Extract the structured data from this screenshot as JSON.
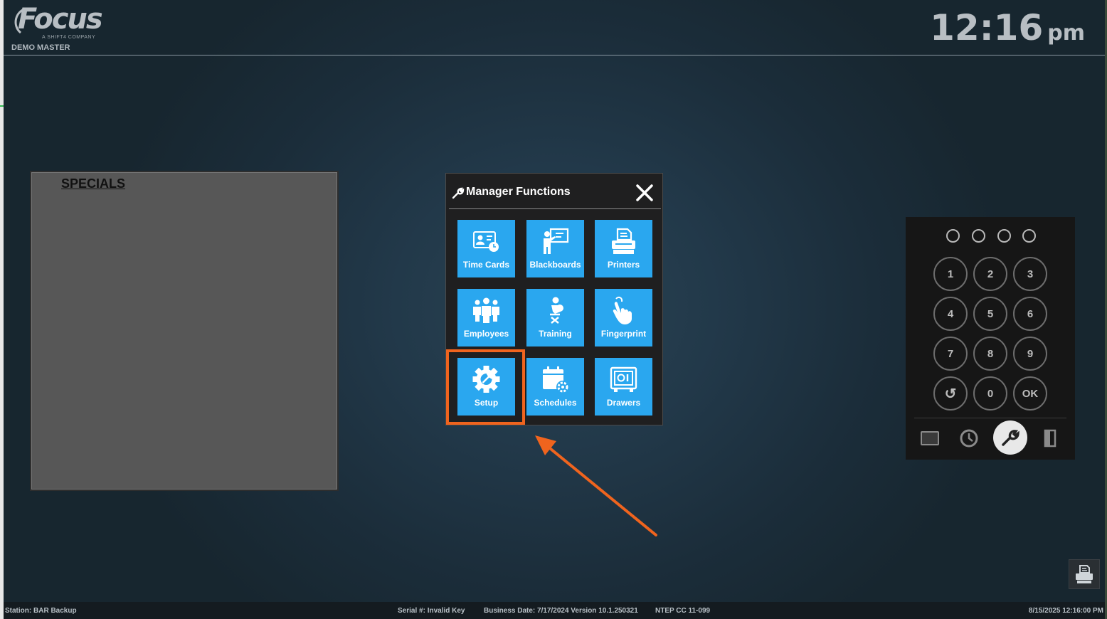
{
  "header": {
    "logo_word": "Focus",
    "logo_sub": "A SHIFT4 COMPANY",
    "store_name": "DEMO MASTER",
    "time": "12:16",
    "ampm": "pm"
  },
  "specials": {
    "title": "SPECIALS"
  },
  "manager_functions": {
    "title": "Manager Functions",
    "tiles": [
      {
        "label": "Time Cards",
        "icon": "time-card-icon"
      },
      {
        "label": "Blackboards",
        "icon": "blackboard-icon"
      },
      {
        "label": "Printers",
        "icon": "printer-icon"
      },
      {
        "label": "Employees",
        "icon": "employees-icon"
      },
      {
        "label": "Training",
        "icon": "training-icon"
      },
      {
        "label": "Fingerprint",
        "icon": "fingerprint-icon"
      },
      {
        "label": "Setup",
        "icon": "setup-gear-icon"
      },
      {
        "label": "Schedules",
        "icon": "schedules-icon"
      },
      {
        "label": "Drawers",
        "icon": "drawer-safe-icon"
      }
    ],
    "highlighted_tile": "Setup",
    "highlight_color": "#f0641e",
    "tile_color": "#2aa7ef"
  },
  "keypad": {
    "keys": [
      "1",
      "2",
      "3",
      "4",
      "5",
      "6",
      "7",
      "8",
      "9",
      "↺",
      "0",
      "OK"
    ],
    "tools": [
      "screen-icon",
      "clock-icon",
      "wrench-icon",
      "exit-door-icon"
    ],
    "active_tool": "wrench-icon"
  },
  "statusbar": {
    "station": "Station: BAR Backup",
    "serial": "Serial #: Invalid Key",
    "business_date": "Business Date: 7/17/2024 Version 10.1.250321",
    "ntep": "NTEP CC 11-099",
    "datetime": "8/15/2025 12:16:00 PM"
  }
}
